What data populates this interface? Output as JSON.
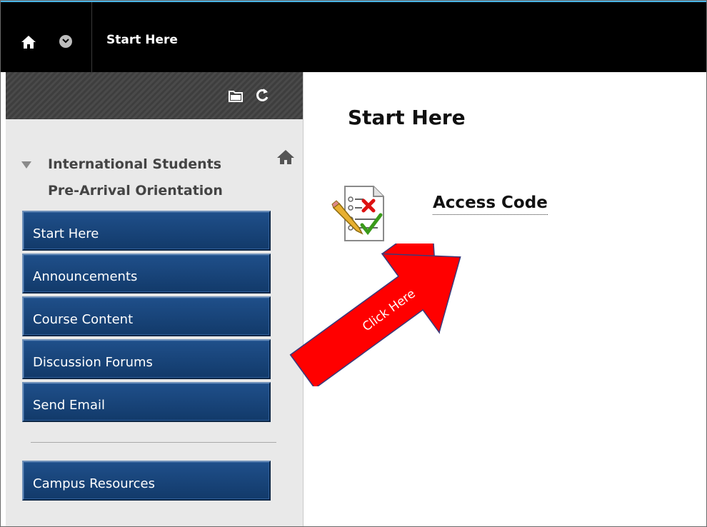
{
  "header": {
    "breadcrumb": "Start Here",
    "home_icon": "home-icon",
    "menu_icon": "chevron-down-icon"
  },
  "sidebar": {
    "tools": {
      "folder_icon": "folder-view-icon",
      "refresh_icon": "refresh-icon"
    },
    "course_line1": "International Students",
    "course_line2": "Pre-Arrival Orientation",
    "items": [
      {
        "label": "Start Here"
      },
      {
        "label": "Announcements"
      },
      {
        "label": "Course Content"
      },
      {
        "label": "Discussion Forums"
      },
      {
        "label": "Send Email"
      },
      {
        "label": "Campus Resources"
      }
    ]
  },
  "main": {
    "page_title": "Start Here",
    "item_title": "Access Code",
    "item_icon": "test-assessment-icon"
  },
  "annotation": {
    "arrow_text": "Click Here",
    "arrow_color": "#ff0000"
  },
  "colors": {
    "topbar": "#000000",
    "nav_button": "#1a4a82",
    "sidebar_bg": "#e9e9e9"
  }
}
